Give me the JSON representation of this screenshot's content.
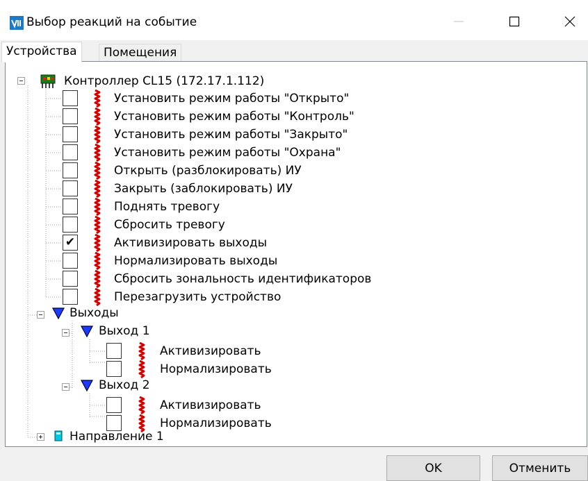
{
  "window": {
    "title": "Выбор реакций на событие",
    "minimize_icon": "minimize-icon",
    "maximize_icon": "maximize-icon",
    "close_icon": "close-icon"
  },
  "tabs": [
    {
      "label": "Устройства",
      "active": true
    },
    {
      "label": "Помещения",
      "active": false
    }
  ],
  "tree": {
    "controller": {
      "label": "Контроллер CL15 (172.17.1.112)",
      "expanded": true,
      "icon": "controller-icon",
      "actions": [
        {
          "label": "Установить режим работы \"Открыто\"",
          "checked": false
        },
        {
          "label": "Установить режим работы \"Контроль\"",
          "checked": false
        },
        {
          "label": "Установить режим работы \"Закрыто\"",
          "checked": false
        },
        {
          "label": "Установить режим работы \"Охрана\"",
          "checked": false
        },
        {
          "label": "Открыть (разблокировать) ИУ",
          "checked": false
        },
        {
          "label": "Закрыть (заблокировать) ИУ",
          "checked": false
        },
        {
          "label": "Поднять тревогу",
          "checked": false
        },
        {
          "label": "Сбросить тревогу",
          "checked": false
        },
        {
          "label": "Активизировать выходы",
          "checked": true
        },
        {
          "label": "Нормализировать выходы",
          "checked": false
        },
        {
          "label": "Сбросить зональность идентификаторов",
          "checked": false
        },
        {
          "label": "Перезагрузить устройство",
          "checked": false
        }
      ]
    },
    "outputs": {
      "label": "Выходы",
      "expanded": true,
      "items": [
        {
          "label": "Выход 1",
          "expanded": true,
          "actions": [
            {
              "label": "Активизировать",
              "checked": false
            },
            {
              "label": "Нормализировать",
              "checked": false
            }
          ]
        },
        {
          "label": "Выход 2",
          "expanded": true,
          "actions": [
            {
              "label": "Активизировать",
              "checked": false
            },
            {
              "label": "Нормализировать",
              "checked": false
            }
          ]
        }
      ]
    },
    "direction": {
      "label": "Направление 1",
      "expanded": false
    }
  },
  "buttons": {
    "ok": "OK",
    "cancel": "Отменить"
  },
  "colors": {
    "reaction_red": "#d50000",
    "output_blue": "#1a3cff",
    "direction_cyan": "#00c8e0",
    "app_icon_blue": "#1f7ac6"
  }
}
